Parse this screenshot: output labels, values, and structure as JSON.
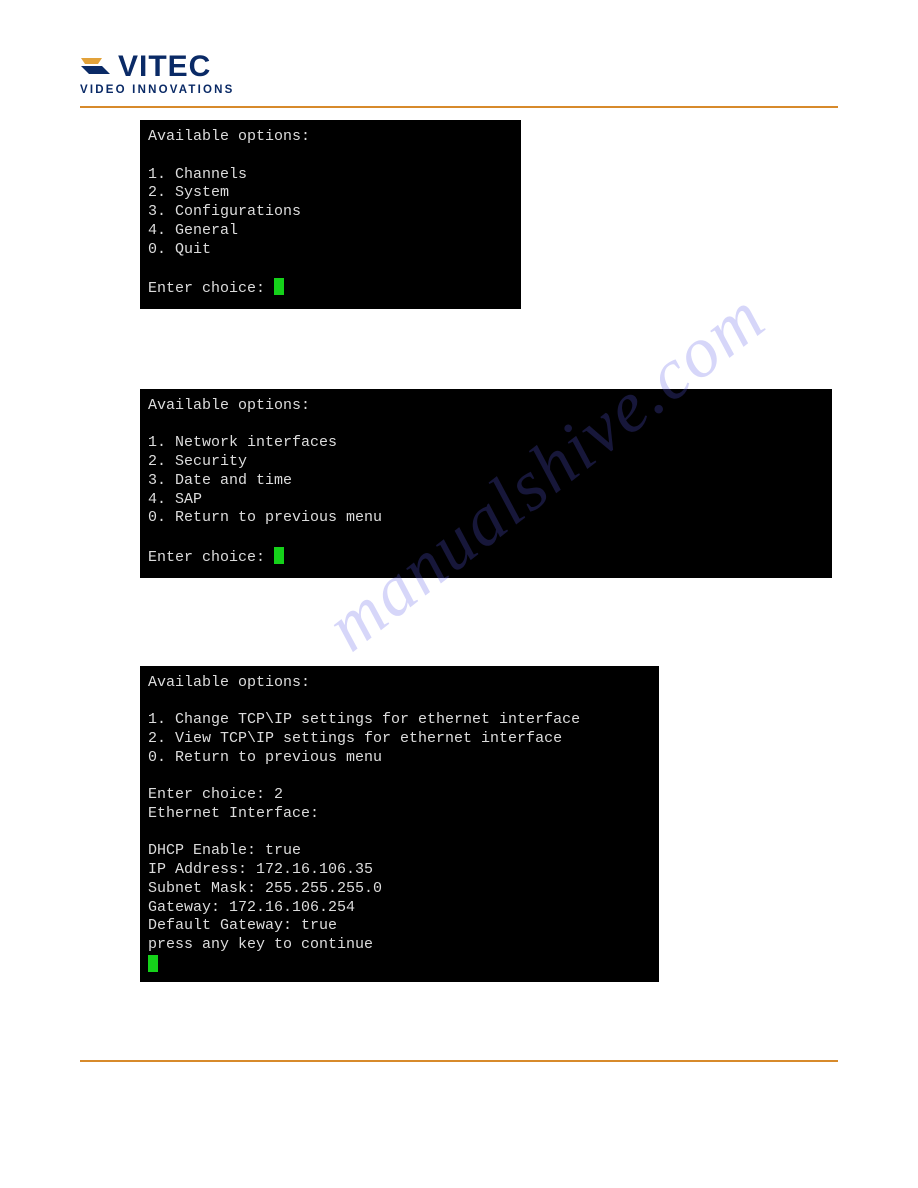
{
  "logo": {
    "name": "VITEC",
    "tagline": "VIDEO INNOVATIONS"
  },
  "watermark": "manualshive.com",
  "terminals": [
    {
      "header": "Available options:",
      "options": [
        "1. Channels",
        "2. System",
        "3. Configurations",
        "4. General",
        "0. Quit"
      ],
      "prompt": "Enter choice: ",
      "entered": "",
      "output": []
    },
    {
      "header": "Available options:",
      "options": [
        "1. Network interfaces",
        "2. Security",
        "3. Date and time",
        "4. SAP",
        "0. Return to previous menu"
      ],
      "prompt": "Enter choice: ",
      "entered": "",
      "output": []
    },
    {
      "header": "Available options:",
      "options": [
        "1. Change TCP\\IP settings for ethernet interface",
        "2. View TCP\\IP settings for ethernet interface",
        "0. Return to previous menu"
      ],
      "prompt": "Enter choice: ",
      "entered": "2",
      "output": [
        "Ethernet Interface:",
        "",
        "DHCP Enable: true",
        "IP Address: 172.16.106.35",
        "Subnet Mask: 255.255.255.0",
        "Gateway: 172.16.106.254",
        "Default Gateway: true",
        "press any key to continue"
      ]
    }
  ]
}
